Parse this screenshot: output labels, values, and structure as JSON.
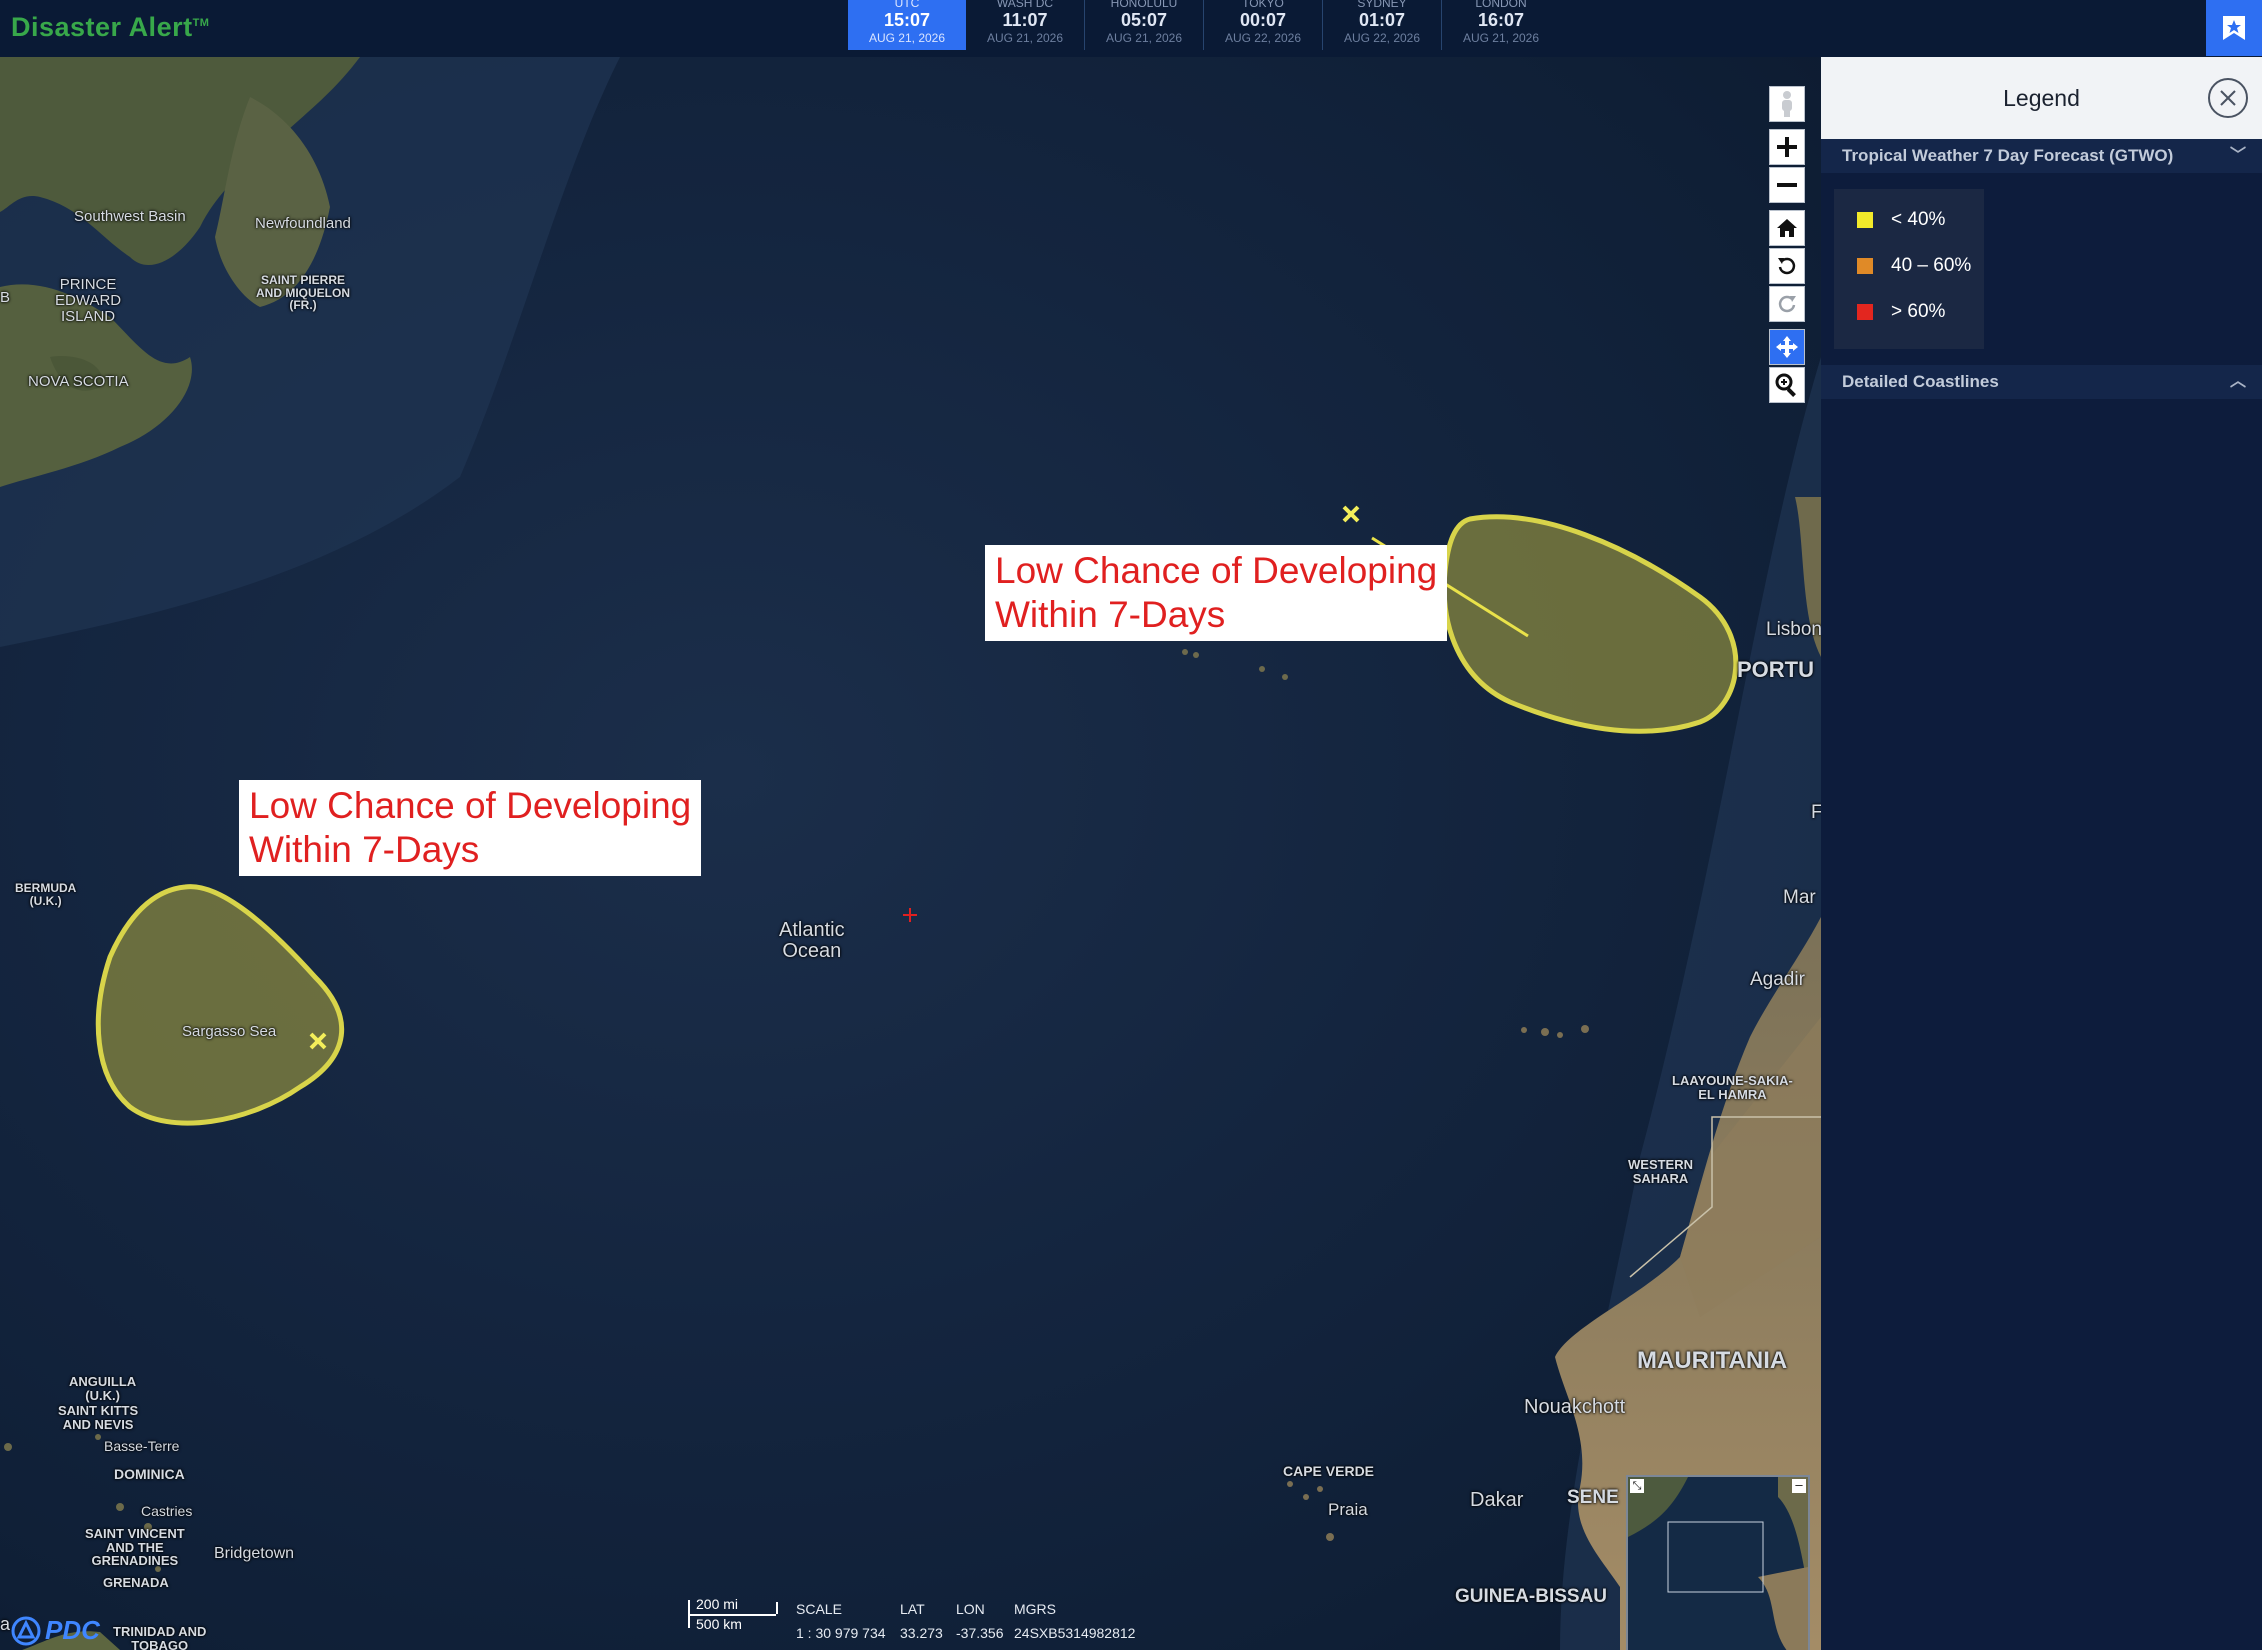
{
  "app": {
    "title": "Disaster Alert",
    "trademark": "TM"
  },
  "clocks": [
    {
      "city": "UTC",
      "time": "15:07",
      "date": "AUG 21, 2026",
      "active": true
    },
    {
      "city": "WASH DC",
      "time": "11:07",
      "date": "AUG 21, 2026"
    },
    {
      "city": "HONOLULU",
      "time": "05:07",
      "date": "AUG 21, 2026"
    },
    {
      "city": "TOKYO",
      "time": "00:07",
      "date": "AUG 22, 2026"
    },
    {
      "city": "SYDNEY",
      "time": "01:07",
      "date": "AUG 22, 2026"
    },
    {
      "city": "LONDON",
      "time": "16:07",
      "date": "AUG 21, 2026"
    }
  ],
  "map": {
    "places": {
      "southwest_basin": "Southwest Basin",
      "newfoundland": "Newfoundland",
      "saint_pierre": "SAINT PIERRE\nAND MIQUELON\n(FR.)",
      "prince_edward": "PRINCE\nEDWARD\nISLAND",
      "nova_scotia": "NOVA SCOTIA",
      "bermuda": "BERMUDA\n(U.K.)",
      "sargasso": "Sargasso Sea",
      "atlantic": "Atlantic\nOcean",
      "lisbon": "Lisbon",
      "portugal": "PORTU",
      "agadir": "Agadir",
      "laayoune": "LAAYOUNE-SAKIA-\nEL HAMRA",
      "western_sahara": "WESTERN\nSAHARA",
      "mauritania": "MAURITANIA",
      "nouakchott": "Nouakchott",
      "cape_verde": "CAPE VERDE",
      "praia": "Praia",
      "dakar": "Dakar",
      "senegal": "SENE",
      "guinea_bissau": "GUINEA-BISSAU",
      "anguilla": "ANGUILLA\n(U.K.)",
      "saint_kitts": "SAINT KITTS\nAND NEVIS",
      "basse_terre": "Basse-Terre",
      "dominica": "DOMINICA",
      "castries": "Castries",
      "saint_vincent": "SAINT VINCENT\nAND THE\nGRENADINES",
      "bridgetown": "Bridgetown",
      "grenada": "GRENADA",
      "trinidad": "TRINIDAD AND\nTOBAGO",
      "mar": "Mar",
      "b_edge": "B",
      "a_edge": "a",
      "r_edge": "F"
    },
    "callouts": [
      "Low Chance of Developing\nWithin 7-Days",
      "Low Chance of Developing\nWithin 7-Days"
    ],
    "watermark": "PDC",
    "scale": {
      "bar_top": "200 mi",
      "bar_bottom": "500 km"
    },
    "coords": {
      "labels": [
        "SCALE",
        "LAT",
        "LON",
        "MGRS"
      ],
      "values": [
        "1 : 30 979 734",
        "33.273",
        "-37.356",
        "24SXB5314982812"
      ]
    },
    "tools": [
      "street-view",
      "zoom-in",
      "zoom-out",
      "home",
      "rotate-left",
      "rotate-right",
      "pan",
      "zoom-box"
    ]
  },
  "legend": {
    "title": "Legend",
    "sections": [
      {
        "title": "Tropical Weather 7 Day Forecast (GTWO)",
        "expanded": true,
        "items": [
          {
            "label": "< 40%",
            "color": "#f2ea2a"
          },
          {
            "label": "40 – 60%",
            "color": "#e08a27"
          },
          {
            "label": "> 60%",
            "color": "#e3261f"
          }
        ]
      },
      {
        "title": "Detailed Coastlines",
        "expanded": false
      }
    ]
  }
}
